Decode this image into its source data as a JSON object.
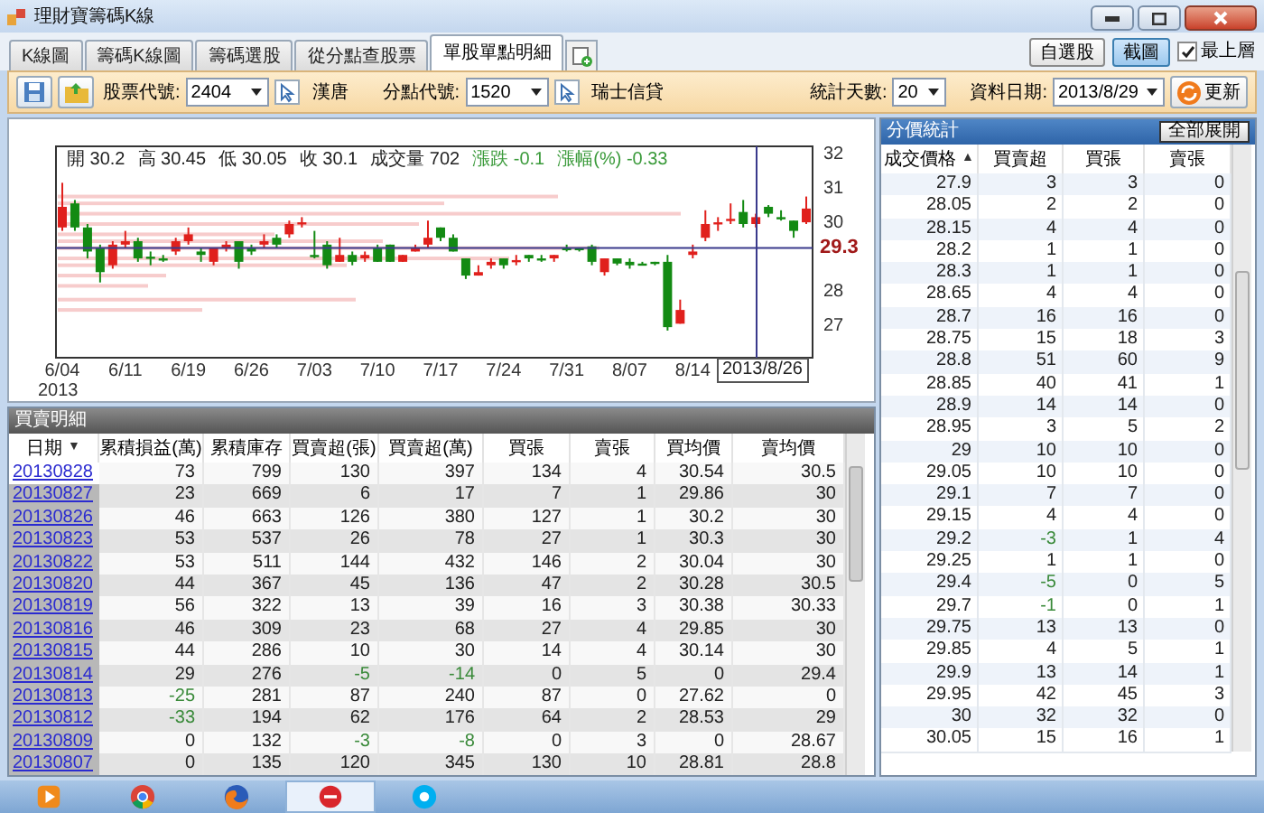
{
  "window": {
    "title": "理財寶籌碼K線"
  },
  "tabs": [
    {
      "label": "K線圖",
      "selected": false
    },
    {
      "label": "籌碼K線圖",
      "selected": false
    },
    {
      "label": "籌碼選股",
      "selected": false
    },
    {
      "label": "從分點查股票",
      "selected": false
    },
    {
      "label": "單股單點明細",
      "selected": true
    }
  ],
  "top_buttons": [
    {
      "label": "自選股",
      "selected": false
    },
    {
      "label": "截圖",
      "selected": true
    }
  ],
  "topmost": {
    "label": "最上層",
    "checked": true
  },
  "toolbar": {
    "stock": {
      "label": "股票代號:",
      "value": "2404",
      "name": "漢唐"
    },
    "branch": {
      "label": "分點代號:",
      "value": "1520",
      "name": "瑞士信貸"
    },
    "days": {
      "label": "統計天數:",
      "value": "20"
    },
    "date": {
      "label": "資料日期:",
      "value": "2013/8/29"
    },
    "refresh": "更新"
  },
  "chart": {
    "info": [
      {
        "label": "開",
        "value": "30.2",
        "kind": "plain"
      },
      {
        "label": "高",
        "value": "30.45",
        "kind": "plain"
      },
      {
        "label": "低",
        "value": "30.05",
        "kind": "plain"
      },
      {
        "label": "收",
        "value": "30.1",
        "kind": "plain"
      },
      {
        "label": "成交量",
        "value": "702",
        "kind": "plain"
      },
      {
        "label": "漲跌",
        "value": "-0.1",
        "kind": "change"
      },
      {
        "label": "漲幅(%)",
        "value": "-0.33",
        "kind": "change"
      }
    ],
    "year": "2013",
    "cursor_date": "2013/8/26",
    "chart_data": {
      "type": "candlestick",
      "categories": [
        "6/04",
        null,
        null,
        null,
        null,
        "6/11",
        null,
        null,
        null,
        null,
        "6/19",
        null,
        null,
        null,
        null,
        "6/26",
        null,
        null,
        null,
        null,
        "7/03",
        null,
        null,
        null,
        null,
        "7/10",
        null,
        null,
        null,
        null,
        "7/17",
        null,
        null,
        null,
        null,
        "7/24",
        null,
        null,
        null,
        null,
        "7/31",
        null,
        null,
        null,
        null,
        "8/07",
        null,
        null,
        null,
        null,
        "8/14",
        null,
        null,
        null,
        null,
        null,
        null,
        null,
        null,
        null
      ],
      "ohlc": [
        [
          29.9,
          31.2,
          29.8,
          30.5
        ],
        [
          30.6,
          30.7,
          29.8,
          29.9
        ],
        [
          29.9,
          30,
          29,
          29.2
        ],
        [
          29.3,
          29.4,
          28.3,
          28.6
        ],
        [
          28.8,
          29.5,
          28.7,
          29.4
        ],
        [
          29.4,
          29.8,
          29.3,
          29.5
        ],
        [
          29.5,
          29.6,
          28.9,
          29
        ],
        [
          29.05,
          29.2,
          28.8,
          29
        ],
        [
          29,
          29.1,
          28.9,
          28.98
        ],
        [
          29.2,
          29.6,
          29.1,
          29.5
        ],
        [
          29.5,
          29.9,
          29.4,
          29.7
        ],
        [
          29.2,
          29.3,
          28.9,
          29.1
        ],
        [
          28.9,
          29.3,
          28.8,
          29.3
        ],
        [
          29.3,
          29.5,
          29.2,
          29.4
        ],
        [
          29.5,
          29.5,
          28.7,
          28.9
        ],
        [
          29.3,
          29.4,
          29.1,
          29.2
        ],
        [
          29.4,
          29.7,
          29.3,
          29.5
        ],
        [
          29.6,
          29.7,
          29.3,
          29.4
        ],
        [
          29.7,
          30.1,
          29.6,
          30
        ],
        [
          30,
          30.2,
          29.9,
          30.05
        ],
        [
          29.1,
          29.8,
          29,
          29.08
        ],
        [
          29.4,
          29.5,
          28.7,
          28.8
        ],
        [
          28.9,
          29.6,
          28.9,
          29.1
        ],
        [
          29.1,
          29.2,
          28.8,
          28.9
        ],
        [
          29,
          29.2,
          28.9,
          29.1
        ],
        [
          29.3,
          29.4,
          28.9,
          28.9
        ],
        [
          29.4,
          29.4,
          28.9,
          28.9
        ],
        [
          28.9,
          29.1,
          28.9,
          29.1
        ],
        [
          29.2,
          29.4,
          29.2,
          29.3
        ],
        [
          29.4,
          30.1,
          29.3,
          29.6
        ],
        [
          29.9,
          29.9,
          29.5,
          29.6
        ],
        [
          29.6,
          29.7,
          29.2,
          29.2
        ],
        [
          29,
          29,
          28.4,
          28.5
        ],
        [
          28.5,
          28.8,
          28.5,
          28.6
        ],
        [
          28.8,
          29,
          28.7,
          28.9
        ],
        [
          29,
          29,
          28.7,
          28.8
        ],
        [
          28.9,
          29.1,
          28.8,
          28.95
        ],
        [
          29.1,
          29.1,
          28.9,
          29
        ],
        [
          29,
          29.1,
          28.9,
          28.95
        ],
        [
          29,
          29.1,
          28.9,
          29.1
        ],
        [
          29.3,
          29.4,
          29.2,
          29.25
        ],
        [
          29.3,
          29.3,
          29.2,
          29.25
        ],
        [
          29.35,
          29.4,
          28.8,
          28.9
        ],
        [
          28.6,
          29,
          28.5,
          29
        ],
        [
          29,
          29,
          28.8,
          28.85
        ],
        [
          28.9,
          29,
          28.7,
          28.8
        ],
        [
          28.85,
          28.9,
          28.8,
          28.82
        ],
        [
          28.9,
          28.9,
          28.8,
          28.85
        ],
        [
          28.9,
          29.1,
          26.9,
          27
        ],
        [
          27.1,
          27.8,
          27.1,
          27.5
        ],
        [
          29.1,
          29.4,
          29,
          29.2
        ],
        [
          29.6,
          30.4,
          29.5,
          30
        ],
        [
          30,
          30.2,
          29.8,
          30.05
        ],
        [
          30.1,
          30.6,
          30,
          30.15
        ],
        [
          30.35,
          30.7,
          29.9,
          30
        ],
        [
          30,
          30.3,
          29.9,
          30.2
        ],
        [
          30.5,
          30.55,
          30.2,
          30.3
        ],
        [
          30.2,
          30.4,
          30.1,
          30.15
        ],
        [
          30.1,
          30.1,
          29.6,
          29.8
        ],
        [
          30.05,
          30.8,
          30,
          30.45
        ]
      ],
      "ylim": [
        26.11,
        32.26
      ],
      "ref_lines": [
        {
          "axis": "y",
          "value": 29.3,
          "label": "29.3"
        }
      ],
      "yticks": [
        27,
        28,
        30,
        31,
        32
      ]
    }
  },
  "trades": {
    "title": "買賣明細",
    "columns": [
      {
        "label": "日期",
        "sort_icon": "▼"
      },
      {
        "label": "累積損益(萬)"
      },
      {
        "label": "累積庫存"
      },
      {
        "label": "買賣超(張)"
      },
      {
        "label": "買賣超(萬)"
      },
      {
        "label": "買張"
      },
      {
        "label": "賣張"
      },
      {
        "label": "買均價"
      },
      {
        "label": "賣均價"
      }
    ],
    "rows": [
      {
        "selected": true,
        "cells": [
          "20130828",
          "73",
          "799",
          "130",
          "397",
          "134",
          "4",
          "30.54",
          "30.5"
        ]
      },
      {
        "selected": false,
        "cells": [
          "20130827",
          "23",
          "669",
          "6",
          "17",
          "7",
          "1",
          "29.86",
          "30"
        ]
      },
      {
        "selected": false,
        "cells": [
          "20130826",
          "46",
          "663",
          "126",
          "380",
          "127",
          "1",
          "30.2",
          "30"
        ]
      },
      {
        "selected": false,
        "cells": [
          "20130823",
          "53",
          "537",
          "26",
          "78",
          "27",
          "1",
          "30.3",
          "30"
        ]
      },
      {
        "selected": false,
        "cells": [
          "20130822",
          "53",
          "511",
          "144",
          "432",
          "146",
          "2",
          "30.04",
          "30"
        ]
      },
      {
        "selected": false,
        "cells": [
          "20130820",
          "44",
          "367",
          "45",
          "136",
          "47",
          "2",
          "30.28",
          "30.5"
        ]
      },
      {
        "selected": false,
        "cells": [
          "20130819",
          "56",
          "322",
          "13",
          "39",
          "16",
          "3",
          "30.38",
          "30.33"
        ]
      },
      {
        "selected": false,
        "cells": [
          "20130816",
          "46",
          "309",
          "23",
          "68",
          "27",
          "4",
          "29.85",
          "30"
        ]
      },
      {
        "selected": false,
        "cells": [
          "20130815",
          "44",
          "286",
          "10",
          "30",
          "14",
          "4",
          "30.14",
          "30"
        ]
      },
      {
        "selected": false,
        "cells": [
          "20130814",
          "29",
          "276",
          {
            "text": "-5",
            "down": true
          },
          {
            "text": "-14",
            "down": true
          },
          "0",
          "5",
          "0",
          "29.4"
        ]
      },
      {
        "selected": false,
        "cells": [
          "20130813",
          {
            "text": "-25",
            "down": true
          },
          "281",
          "87",
          "240",
          "87",
          "0",
          "27.62",
          "0"
        ]
      },
      {
        "selected": false,
        "cells": [
          "20130812",
          {
            "text": "-33",
            "down": true
          },
          "194",
          "62",
          "176",
          "64",
          "2",
          "28.53",
          "29"
        ]
      },
      {
        "selected": false,
        "cells": [
          "20130809",
          "0",
          "132",
          {
            "text": "-3",
            "down": true
          },
          {
            "text": "-8",
            "down": true
          },
          "0",
          "3",
          "0",
          "28.67"
        ]
      },
      {
        "selected": false,
        "cells": [
          "20130807",
          "0",
          "135",
          "120",
          "345",
          "130",
          "10",
          "28.81",
          "28.8"
        ]
      }
    ]
  },
  "price_stats": {
    "title": "分價統計",
    "expand_button": "全部展開",
    "columns": [
      {
        "label": "成交價格",
        "sort_icon": "▲"
      },
      {
        "label": "買賣超"
      },
      {
        "label": "買張"
      },
      {
        "label": "賣張"
      }
    ],
    "rows": [
      [
        "27.9",
        "3",
        "3",
        "0"
      ],
      [
        "28.05",
        "2",
        "2",
        "0"
      ],
      [
        "28.15",
        "4",
        "4",
        "0"
      ],
      [
        "28.2",
        "1",
        "1",
        "0"
      ],
      [
        "28.3",
        "1",
        "1",
        "0"
      ],
      [
        "28.65",
        "4",
        "4",
        "0"
      ],
      [
        "28.7",
        "16",
        "16",
        "0"
      ],
      [
        "28.75",
        "15",
        "18",
        "3"
      ],
      [
        "28.8",
        "51",
        "60",
        "9"
      ],
      [
        "28.85",
        "40",
        "41",
        "1"
      ],
      [
        "28.9",
        "14",
        "14",
        "0"
      ],
      [
        "28.95",
        "3",
        "5",
        "2"
      ],
      [
        "29",
        "10",
        "10",
        "0"
      ],
      [
        "29.05",
        "10",
        "10",
        "0"
      ],
      [
        "29.1",
        "7",
        "7",
        "0"
      ],
      [
        "29.15",
        "4",
        "4",
        "0"
      ],
      [
        "29.2",
        {
          "text": "-3",
          "down": true
        },
        "1",
        "4"
      ],
      [
        "29.25",
        "1",
        "1",
        "0"
      ],
      [
        "29.4",
        {
          "text": "-5",
          "down": true
        },
        "0",
        "5"
      ],
      [
        "29.7",
        {
          "text": "-1",
          "down": true
        },
        "0",
        "1"
      ],
      [
        "29.75",
        "13",
        "13",
        "0"
      ],
      [
        "29.85",
        "4",
        "5",
        "1"
      ],
      [
        "29.9",
        "13",
        "14",
        "1"
      ],
      [
        "29.95",
        "42",
        "45",
        "3"
      ],
      [
        "30",
        "32",
        "32",
        "0"
      ],
      [
        "30.05",
        "15",
        "16",
        "1"
      ]
    ]
  },
  "taskbar": {
    "apps": [
      {
        "kind": "media",
        "active": false
      },
      {
        "kind": "chrome",
        "active": false
      },
      {
        "kind": "firefox",
        "active": false
      },
      {
        "kind": "stock",
        "active": true
      },
      {
        "kind": "skype",
        "active": false
      }
    ]
  }
}
